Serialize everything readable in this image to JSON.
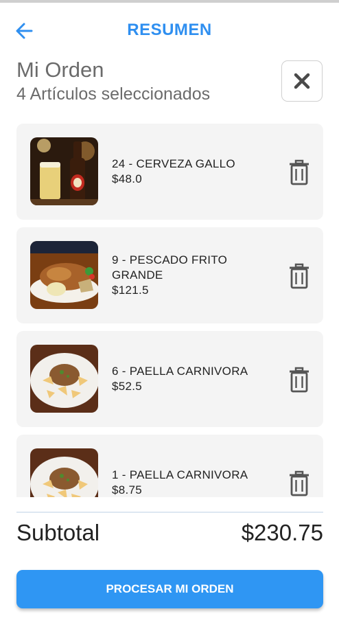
{
  "header": {
    "title": "RESUMEN",
    "back_icon": "arrow-left-icon",
    "accent_color": "#2f8ff0"
  },
  "order": {
    "title": "Mi Orden",
    "subtitle": "4 Artículos seleccionados",
    "close_icon": "close-icon"
  },
  "items": [
    {
      "name": "24 - CERVEZA GALLO",
      "price": "$48.0",
      "image": "beer-photo"
    },
    {
      "name_line1": "9 - PESCADO FRITO",
      "name_line2": "GRANDE",
      "price": "$121.5",
      "image": "fried-fish-photo"
    },
    {
      "name": "6 - PAELLA CARNIVORA",
      "price": "$52.5",
      "image": "paella-photo"
    },
    {
      "name": "1 - PAELLA CARNIVORA",
      "price": "$8.75",
      "image": "paella-photo"
    }
  ],
  "item_action_icon": "trash-icon",
  "summary": {
    "subtotal_label": "Subtotal",
    "subtotal_value": "$230.75"
  },
  "actions": {
    "process_label": "PROCESAR MI ORDEN",
    "button_color": "#2f96f3"
  }
}
